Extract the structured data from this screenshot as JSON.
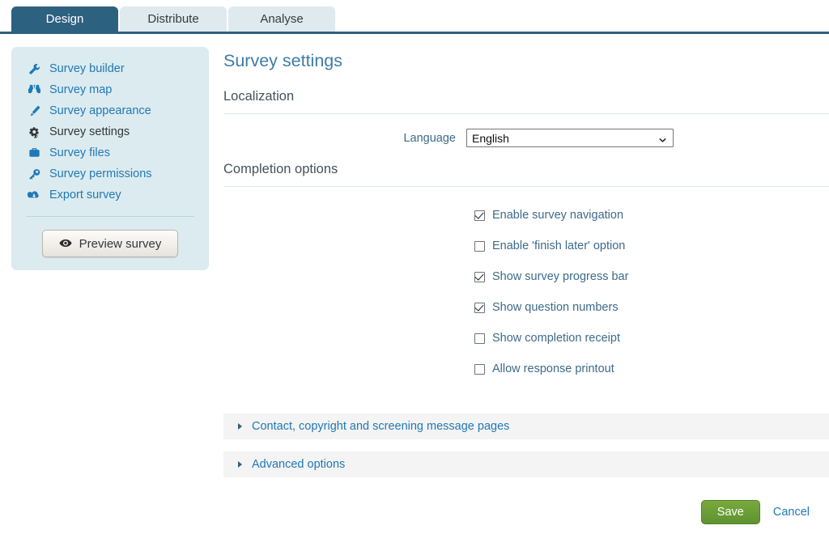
{
  "tabs": [
    {
      "label": "Design",
      "active": true
    },
    {
      "label": "Distribute",
      "active": false
    },
    {
      "label": "Analyse",
      "active": false
    }
  ],
  "sidebar": {
    "items": [
      {
        "label": "Survey builder",
        "icon": "wrench-icon",
        "active": false
      },
      {
        "label": "Survey map",
        "icon": "map-icon",
        "active": false
      },
      {
        "label": "Survey appearance",
        "icon": "pencil-icon",
        "active": false
      },
      {
        "label": "Survey settings",
        "icon": "gears-icon",
        "active": true
      },
      {
        "label": "Survey files",
        "icon": "briefcase-icon",
        "active": false
      },
      {
        "label": "Survey permissions",
        "icon": "key-icon",
        "active": false
      },
      {
        "label": "Export survey",
        "icon": "cloud-download-icon",
        "active": false
      }
    ],
    "preview_button": "Preview survey",
    "preview_icon": "eye-icon"
  },
  "main": {
    "page_title": "Survey settings",
    "localization": {
      "heading": "Localization",
      "language_label": "Language",
      "language_value": "English",
      "language_options": [
        "English"
      ]
    },
    "completion": {
      "heading": "Completion options",
      "options": [
        {
          "label": "Enable survey navigation",
          "checked": true
        },
        {
          "label": "Enable 'finish later' option",
          "checked": false
        },
        {
          "label": "Show survey progress bar",
          "checked": true
        },
        {
          "label": "Show question numbers",
          "checked": true
        },
        {
          "label": "Show completion receipt",
          "checked": false
        },
        {
          "label": "Allow response printout",
          "checked": false
        }
      ]
    },
    "accordions": [
      {
        "label": "Contact, copyright and screening message pages",
        "expanded": false
      },
      {
        "label": "Advanced options",
        "expanded": false
      }
    ]
  },
  "footer": {
    "save_label": "Save",
    "cancel_label": "Cancel"
  },
  "colors": {
    "active_tab": "#2d6180",
    "inactive_tab": "#dfeaee",
    "sidebar_bg": "#dcebf0",
    "link": "#2079b5",
    "title": "#3d7ca8",
    "label": "#3d6a88",
    "save_green": "#5f9330",
    "accordion_bg": "#f4f4f5"
  }
}
